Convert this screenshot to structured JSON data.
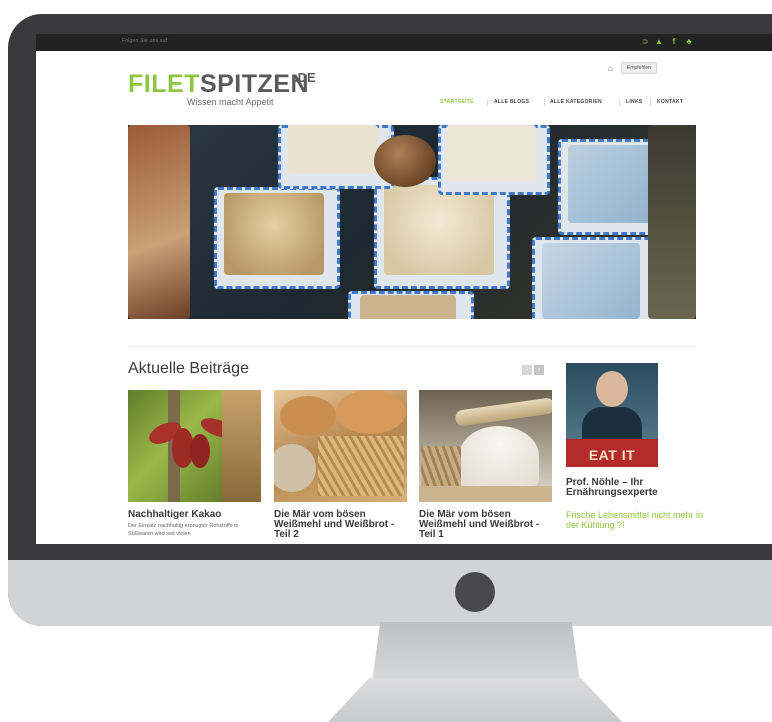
{
  "colors": {
    "accent": "#8dc63f",
    "topbar": "#222222",
    "bezel": "#3a3a3c",
    "chin": "#d2d3d5"
  },
  "topbar": {
    "tagline": "Folgen Sie uns auf:",
    "social_icons": [
      "rss-icon",
      "delicious-icon",
      "facebook-icon",
      "leaf-icon"
    ]
  },
  "header": {
    "logo_part1": "FILET",
    "logo_part2": "SPITZEN",
    "logo_domain": ".DE",
    "tagline": "Wissen macht Appetit",
    "print_icon": "print-icon",
    "like_label": "Empfehlen"
  },
  "nav": {
    "items": [
      {
        "label": "STARTSEITE",
        "active": true
      },
      {
        "label": "ALLE BLOGS",
        "active": false
      },
      {
        "label": "ALLE KATEGORIEN",
        "active": false
      },
      {
        "label": "LINKS",
        "active": false
      },
      {
        "label": "KONTAKT",
        "active": false
      }
    ]
  },
  "posts": {
    "section_title": "Aktuelle Beiträge",
    "pager_prev": "‹",
    "pager_next": "›",
    "items": [
      {
        "title": "Nachhaltiger Kakao",
        "excerpt": "Der Einsatz nachhaltig erzeugter Rohstoffe in Süßwaren wird seit vielen"
      },
      {
        "title": "Die Mär vom bösen Weißmehl und Weißbrot - Teil 2",
        "excerpt": ""
      },
      {
        "title": "Die Mär vom bösen Weißmehl und Weißbrot - Teil 1",
        "excerpt": ""
      }
    ]
  },
  "sidebar": {
    "ad_text": "EAT IT",
    "title": "Prof. Nöhle – Ihr Ernährungsexperte",
    "link": "Frische Lebensmittel nicht mehr in der Kühlung ?!"
  }
}
